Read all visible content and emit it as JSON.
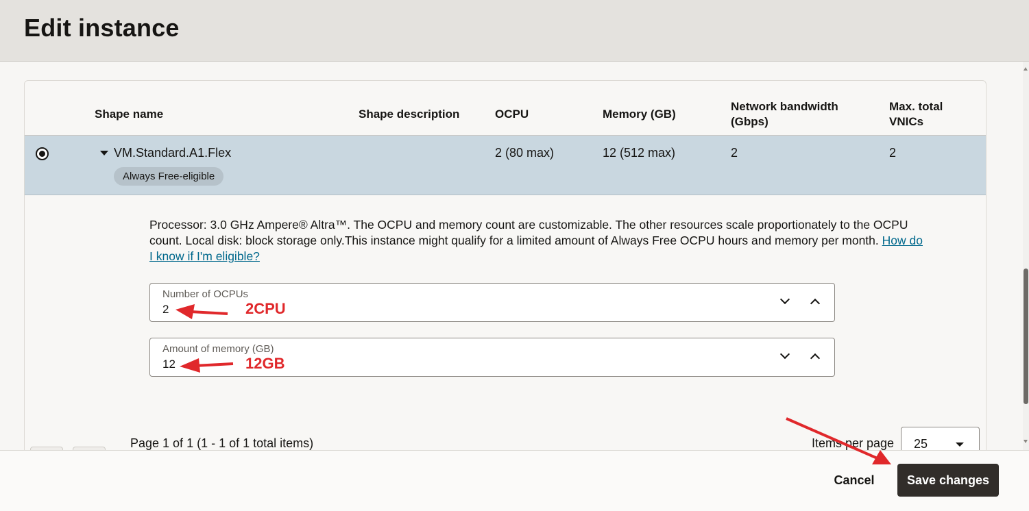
{
  "header": {
    "title": "Edit instance"
  },
  "table": {
    "columns": [
      {
        "label": "Shape name"
      },
      {
        "label": "Shape description"
      },
      {
        "label": "OCPU"
      },
      {
        "label": "Memory (GB)"
      },
      {
        "label": "Network bandwidth (Gbps)"
      },
      {
        "label": "Max. total VNICs"
      }
    ],
    "row": {
      "shape_name": "VM.Standard.A1.Flex",
      "badge": "Always Free-eligible",
      "ocpu": "2 (80 max)",
      "memory": "12 (512 max)",
      "network_bandwidth": "2",
      "max_vnics": "2"
    }
  },
  "details": {
    "description": "Processor: 3.0 GHz Ampere® Altra™. The OCPU and memory count are customizable. The other resources scale proportionately to the OCPU count. Local disk: block storage only.This instance might qualify for a limited amount of Always Free OCPU hours and memory per month. ",
    "link": "How do I know if I'm eligible?"
  },
  "fields": {
    "ocpus": {
      "label": "Number of OCPUs",
      "value": "2",
      "annotation": "2CPU"
    },
    "memory": {
      "label": "Amount of memory (GB)",
      "value": "12",
      "annotation": "12GB"
    }
  },
  "pagination": {
    "info": "Page 1 of 1 (1 - 1 of 1 total items)",
    "items_per_page_label": "Items per page",
    "items_per_page_value": "25"
  },
  "footer": {
    "cancel_label": "Cancel",
    "save_label": "Save changes"
  },
  "colors": {
    "annotation": "#e0282b",
    "selected_row": "#c9d7e0",
    "primary_button": "#312d2a",
    "link": "#00688c"
  },
  "icons": [
    "radio-selected-icon",
    "caret-down-icon",
    "chevron-down-icon",
    "chevron-up-icon",
    "triangle-left-icon",
    "triangle-right-icon",
    "arrow-annotation-icon"
  ]
}
